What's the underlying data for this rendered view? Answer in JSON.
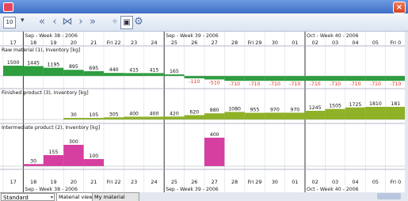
{
  "window": {
    "close_glyph": "×",
    "app_icon": "app-icon"
  },
  "toolbar": {
    "zoom_value": "10",
    "caret": "▾",
    "buttons": [
      {
        "name": "first-page-button",
        "glyph": "«"
      },
      {
        "name": "previous-page-button",
        "glyph": "‹"
      },
      {
        "name": "center-button",
        "glyph": "⋈"
      },
      {
        "name": "next-page-button",
        "glyph": "›"
      },
      {
        "name": "last-page-button",
        "glyph": "»"
      },
      {
        "name": "nav-disabled-button",
        "glyph": "⌖"
      },
      {
        "name": "select-mode-button",
        "glyph": "▣"
      },
      {
        "name": "settings-button",
        "glyph": "⚙"
      }
    ]
  },
  "weeks": [
    {
      "label": "Sep - Week 38 - 2006",
      "start": 1
    },
    {
      "label": "Sep - Week 39 - 2006",
      "start": 8
    },
    {
      "label": "Oct - Week 40 - 2006",
      "start": 15
    }
  ],
  "days": [
    "17",
    "18",
    "19",
    "20",
    "21",
    "Fri 22",
    "23",
    "24",
    "25",
    "26",
    "27",
    "28",
    "Fri 29",
    "30",
    "01",
    "02",
    "03",
    "04",
    "05",
    "Fri 0"
  ],
  "rows": [
    {
      "label": "Raw material (1), Inventory [kg]"
    },
    {
      "label": "Finished product (3), Inventory [kg]"
    },
    {
      "label": "Intermediate product (2), Inventory [kg]"
    }
  ],
  "chart_data": {
    "type": "bar",
    "categories": [
      "17",
      "18",
      "19",
      "20",
      "21",
      "Fri 22",
      "23",
      "24",
      "25",
      "26",
      "27",
      "28",
      "Fri 29",
      "30",
      "01",
      "02",
      "03",
      "04",
      "05",
      "Fri 0"
    ],
    "series": [
      {
        "name": "Raw material (1), Inventory [kg]",
        "color": "#2e9e3e",
        "neg_color": "#2e9e3e",
        "labels": [
          "1500",
          "1445",
          "1195",
          "895",
          "695",
          "440",
          "415",
          "415",
          "165",
          "-110",
          "-510",
          "-710",
          "-710",
          "-710",
          "-710",
          "-710",
          "-710",
          "-710",
          "-710",
          "-710"
        ],
        "values": [
          1500,
          1445,
          1195,
          895,
          695,
          440,
          415,
          415,
          165,
          -110,
          -510,
          -710,
          -710,
          -710,
          -710,
          -710,
          -710,
          -710,
          -710,
          -710
        ]
      },
      {
        "name": "Finished product (3), Inventory [kg]",
        "color": "#8fb128",
        "labels": [
          "",
          "",
          "",
          "30",
          "105",
          "305",
          "400",
          "400",
          "420",
          "620",
          "880",
          "1080",
          "955",
          "970",
          "970",
          "1245",
          "1505",
          "1725",
          "1810",
          "181"
        ],
        "values": [
          0,
          0,
          0,
          30,
          105,
          305,
          400,
          400,
          420,
          620,
          880,
          1080,
          955,
          970,
          970,
          1245,
          1505,
          1725,
          1810,
          1810
        ]
      },
      {
        "name": "Intermediate product (2), Inventory [kg]",
        "color": "#d63ea0",
        "labels": [
          "",
          "30",
          "155",
          "300",
          "100",
          "",
          "",
          "",
          "",
          "",
          "400",
          "",
          "",
          "",
          "",
          "",
          "",
          "",
          "",
          ""
        ],
        "values": [
          0,
          30,
          155,
          300,
          100,
          0,
          0,
          0,
          0,
          0,
          400,
          0,
          0,
          0,
          0,
          0,
          0,
          0,
          0,
          0
        ]
      }
    ]
  },
  "tabs": {
    "select_label": "Standard",
    "dropdown_glyph": "▾",
    "items": [
      "Material view",
      "My material view"
    ]
  }
}
